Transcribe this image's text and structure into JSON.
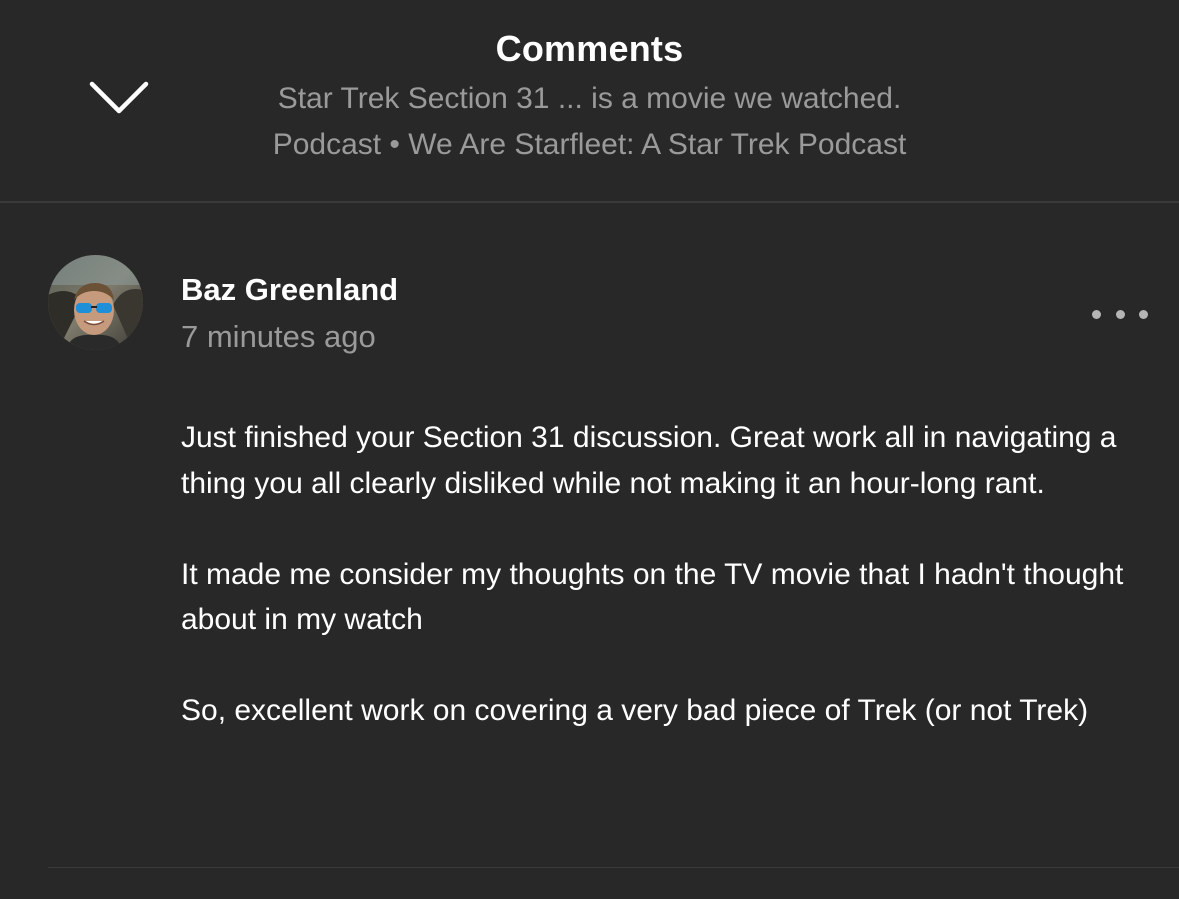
{
  "header": {
    "title": "Comments",
    "episode_title": "Star Trek Section 31 ... is a movie we watched.",
    "podcast_line": "Podcast • We Are Starfleet: A Star Trek Podcast",
    "collapse_icon": "chevron-down-icon"
  },
  "comment": {
    "author": "Baz Greenland",
    "timestamp": "7 minutes ago",
    "more_icon": "more-horizontal-icon",
    "paragraphs": [
      "Just finished your Section 31 discussion. Great work all in navigating a thing you all clearly disliked while not making it an hour-long rant.",
      "It made me consider my thoughts on the TV movie that I hadn't thought about in my watch",
      "So, excellent work on covering a very bad piece of Trek (or not Trek)"
    ]
  },
  "colors": {
    "background": "#282828",
    "text_primary": "#ffffff",
    "text_secondary": "#9a9a9a",
    "divider": "#3a3a3a"
  }
}
